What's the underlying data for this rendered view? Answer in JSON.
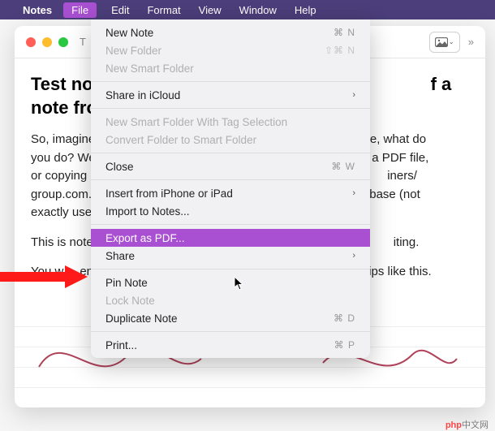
{
  "menubar": {
    "app": "Notes",
    "items": [
      "File",
      "Edit",
      "Format",
      "View",
      "Window",
      "Help"
    ],
    "active_index": 0
  },
  "window": {
    "title_prefix": "T"
  },
  "content": {
    "heading_left": "Test no",
    "heading_right": "f a note from th",
    "para1_left": "So, imagine",
    "para1_right1": "ile, what do",
    "para2_left": "you do? We",
    "para2_right": "e as a PDF file,",
    "para3_left": "or copying",
    "para3_right": "iners/",
    "para4_left": "group.com.",
    "para4_right": "latabase (not",
    "para5_left": "exactly use",
    "line2_left": "This is note",
    "line2_right": "iting.",
    "line3_left": "You w",
    "line3_mid": "enj",
    "line3_right": "at tips like this."
  },
  "menu": {
    "items": [
      {
        "label": "New Note",
        "shortcut": "⌘ N",
        "disabled": false
      },
      {
        "label": "New Folder",
        "shortcut": "⇧⌘ N",
        "disabled": true
      },
      {
        "label": "New Smart Folder",
        "disabled": true
      },
      {
        "sep": true
      },
      {
        "label": "Share in iCloud",
        "submenu": true
      },
      {
        "sep": true
      },
      {
        "label": "New Smart Folder With Tag Selection",
        "disabled": true
      },
      {
        "label": "Convert Folder to Smart Folder",
        "disabled": true
      },
      {
        "sep": true
      },
      {
        "label": "Close",
        "shortcut": "⌘ W"
      },
      {
        "sep": true
      },
      {
        "label": "Insert from iPhone or iPad",
        "submenu": true
      },
      {
        "label": "Import to Notes..."
      },
      {
        "sep": true
      },
      {
        "label": "Export as PDF...",
        "highlighted": true
      },
      {
        "label": "Share",
        "submenu": true
      },
      {
        "sep": true
      },
      {
        "label": "Pin Note"
      },
      {
        "label": "Lock Note",
        "disabled": true
      },
      {
        "label": "Duplicate Note",
        "shortcut": "⌘ D"
      },
      {
        "sep": true
      },
      {
        "label": "Print...",
        "shortcut": "⌘ P"
      }
    ]
  },
  "watermark": {
    "left": "php",
    "right": "中文网"
  }
}
